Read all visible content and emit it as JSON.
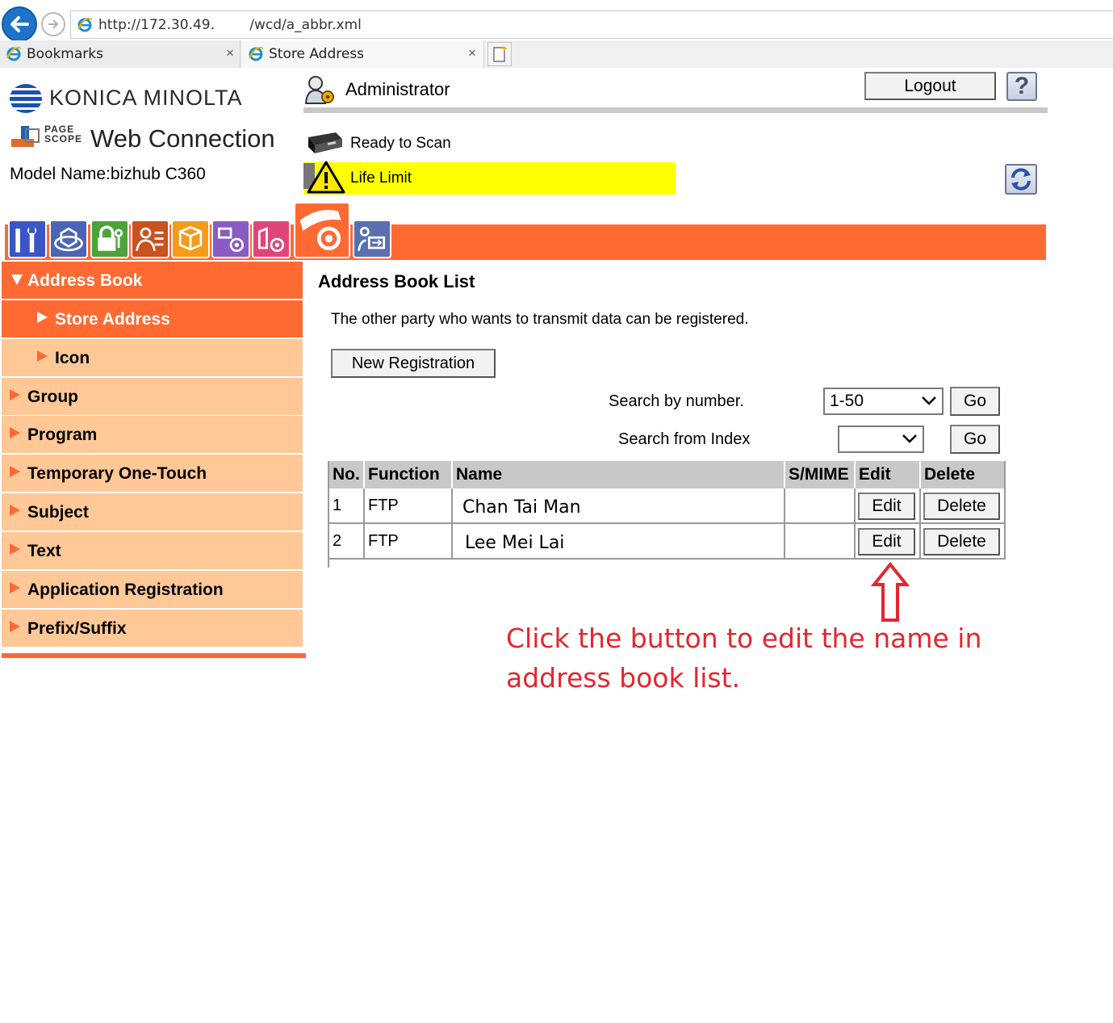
{
  "browser": {
    "url_part1": "http://172.30.49.",
    "url_part2": "/wcd/a_abbr.xml",
    "tabs": [
      {
        "label": "Bookmarks",
        "close": "×"
      },
      {
        "label": "Store Address",
        "close": "×"
      }
    ]
  },
  "header": {
    "brand": "KONICA MINOLTA",
    "pagescope_line1": "PAGE",
    "pagescope_line2": "SCOPE",
    "product": "Web Connection",
    "model_name": "Model Name:bizhub C360",
    "user_role": "Administrator",
    "logout_label": "Logout",
    "help_label": "?",
    "status_scan": "Ready to Scan",
    "status_warning": "Life Limit",
    "warning_color": "#ffff00"
  },
  "categories": [
    {
      "icon": "maintenance-icon"
    },
    {
      "icon": "system-settings-icon"
    },
    {
      "icon": "security-icon"
    },
    {
      "icon": "user-auth-icon"
    },
    {
      "icon": "box-icon"
    },
    {
      "icon": "print-settings-icon"
    },
    {
      "icon": "fax-settings-icon"
    },
    {
      "icon": "store-address-icon",
      "active": true
    },
    {
      "icon": "network-icon"
    }
  ],
  "sidebar": {
    "accent_color": "#ff6a33",
    "items": [
      {
        "label": "Address Book",
        "state": "open"
      },
      {
        "label": "Store Address",
        "state": "selected-sub"
      },
      {
        "label": "Icon",
        "state": "sub"
      },
      {
        "label": "Group",
        "state": "closed"
      },
      {
        "label": "Program",
        "state": "closed"
      },
      {
        "label": "Temporary One-Touch",
        "state": "closed"
      },
      {
        "label": "Subject",
        "state": "closed"
      },
      {
        "label": "Text",
        "state": "closed"
      },
      {
        "label": "Application Registration",
        "state": "closed"
      },
      {
        "label": "Prefix/Suffix",
        "state": "closed"
      }
    ]
  },
  "content": {
    "title": "Address Book List",
    "description": "The other party who wants to transmit data can be registered.",
    "new_registration_label": "New Registration",
    "search_number_label": "Search by number.",
    "search_number_value": "1-50",
    "search_index_label": "Search from Index",
    "search_index_value": "",
    "go_label": "Go",
    "table": {
      "headers": [
        "No.",
        "Function",
        "Name",
        "S/MIME",
        "Edit",
        "Delete"
      ],
      "rows": [
        {
          "no": "1",
          "function": "FTP",
          "name": "Chan Tai Man",
          "smime": "",
          "edit": "Edit",
          "delete": "Delete"
        },
        {
          "no": "2",
          "function": "FTP",
          "name": "Lee Mei Lai",
          "smime": "",
          "edit": "Edit",
          "delete": "Delete"
        }
      ]
    }
  },
  "annotation": {
    "text": "Click the button to edit the name in address book list.",
    "color": "#e3262f"
  }
}
